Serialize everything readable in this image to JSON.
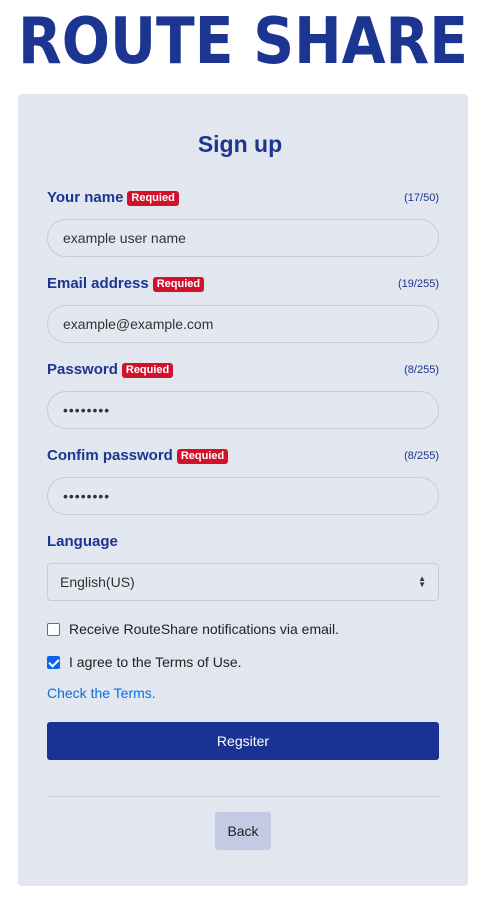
{
  "brand": {
    "logo_text": "ROUTE SHARE",
    "colors": {
      "primary": "#1c3591",
      "required": "#d0122b",
      "link": "#0c6fd8",
      "card_bg": "#e1e6ef"
    }
  },
  "form": {
    "title": "Sign up",
    "required_badge": "Requied",
    "fields": {
      "name": {
        "label": "Your name",
        "counter": "(17/50)",
        "value": "example user name"
      },
      "email": {
        "label": "Email address",
        "counter": "(19/255)",
        "value": "example@example.com"
      },
      "password": {
        "label": "Password",
        "counter": "(8/255)",
        "value": "••••••••"
      },
      "confirm": {
        "label": "Confim password",
        "counter": "(8/255)",
        "value": "••••••••"
      }
    },
    "language": {
      "label": "Language",
      "selected": "English(US)"
    },
    "checkboxes": {
      "notifications": {
        "label": "Receive RouteShare notifications via email.",
        "checked": false
      },
      "terms": {
        "label": "I agree to the Terms of Use.",
        "checked": true
      }
    },
    "terms_link": "Check the Terms.",
    "register_label": "Regsiter",
    "back_label": "Back"
  }
}
